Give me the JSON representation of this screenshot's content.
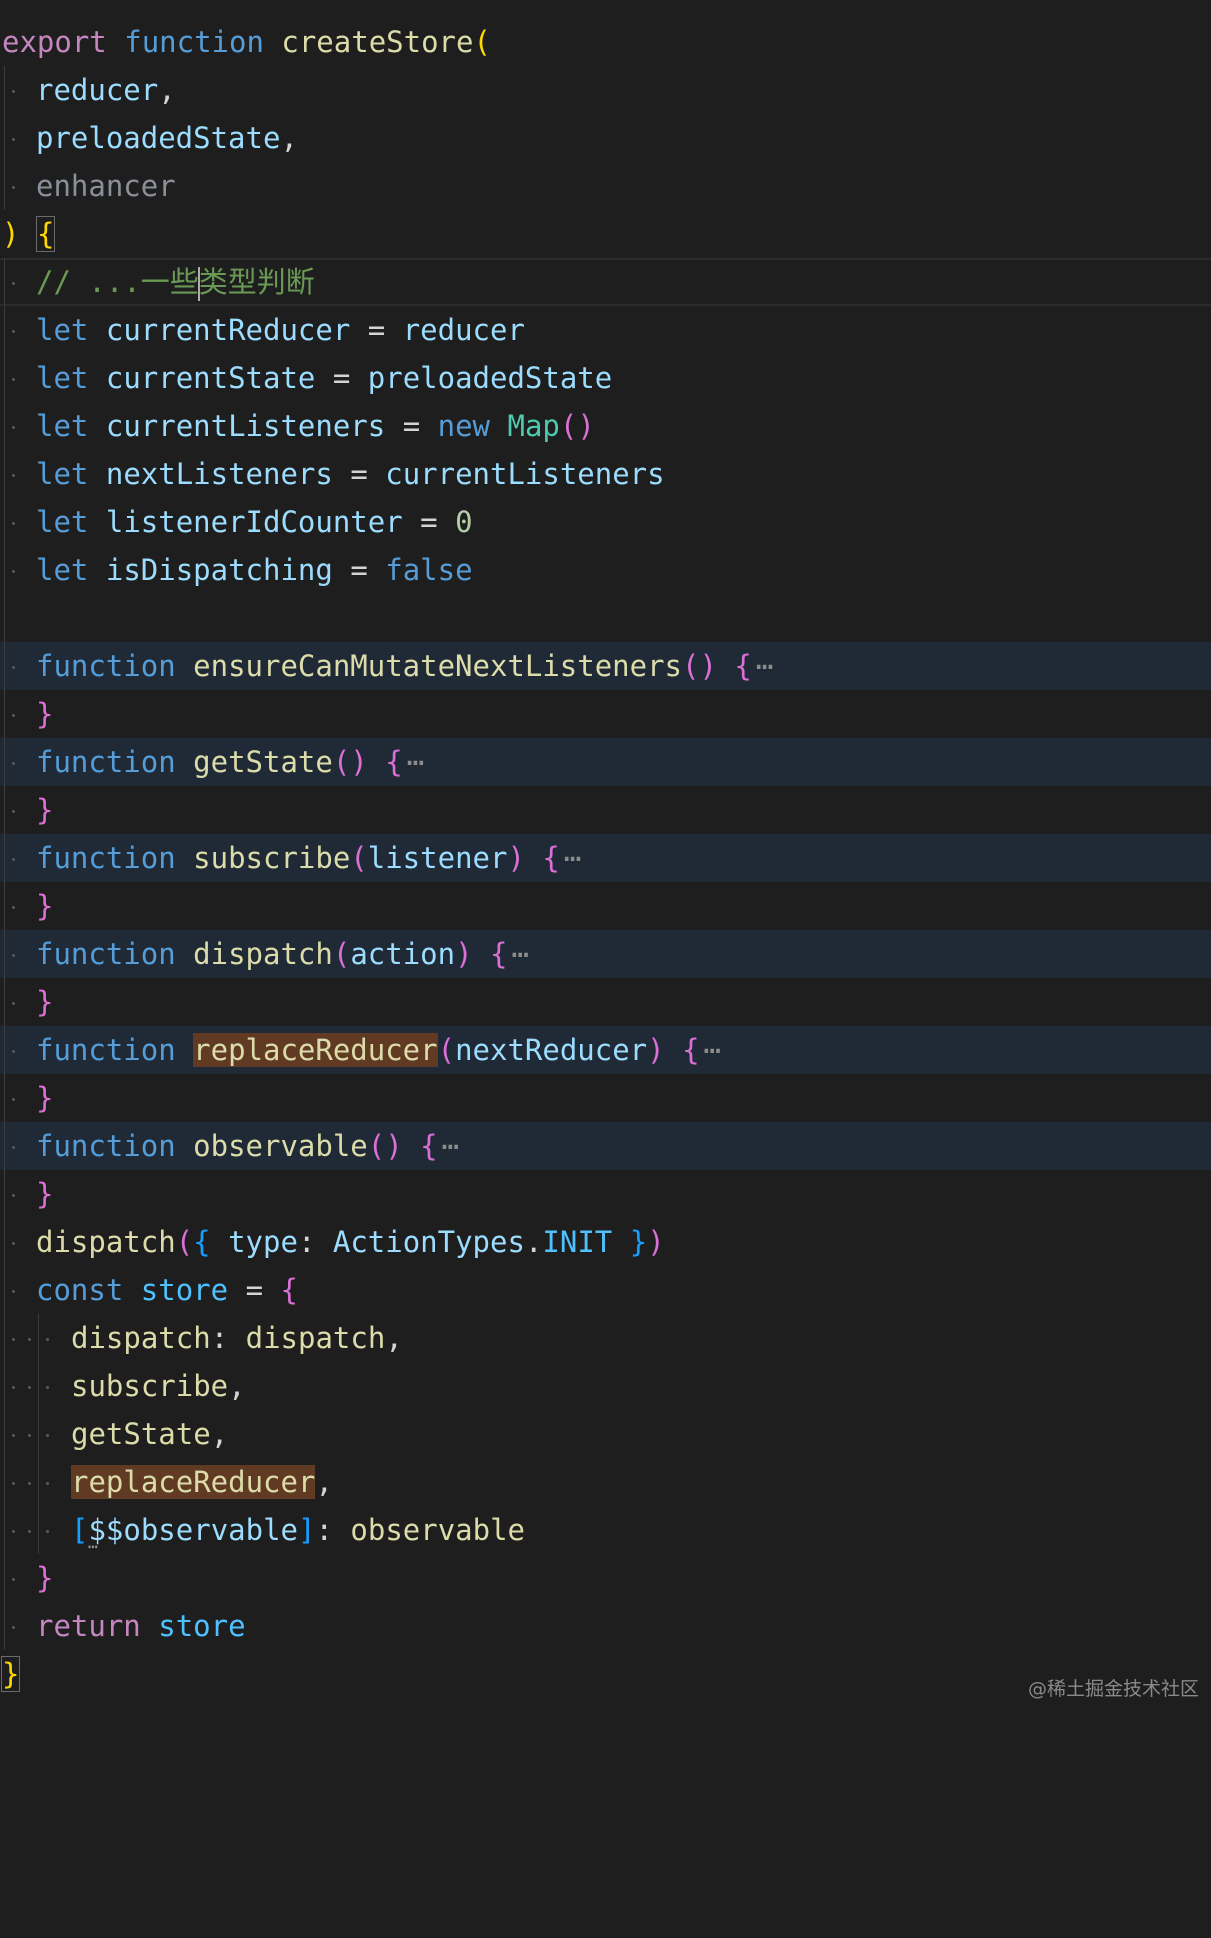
{
  "editor": {
    "language": "javascript",
    "theme": "dark",
    "colors": {
      "background": "#1e1e1e",
      "folded_region_highlight": "#1f2a36",
      "occurrence_highlight": "#613a24",
      "keyword": "#569cd6",
      "control_keyword": "#c586c0",
      "function_name": "#dcdcaa",
      "variable": "#9cdcfe",
      "comment": "#6a9955",
      "bracket_level_1": "#ffd700",
      "bracket_level_2": "#da70d6",
      "bracket_level_3": "#179fff"
    },
    "lines": [
      {
        "id": "l1",
        "text": "export function createStore("
      },
      {
        "id": "l2",
        "text": "reducer,"
      },
      {
        "id": "l3",
        "text": "preloadedState,"
      },
      {
        "id": "l4",
        "text": "enhancer"
      },
      {
        "id": "l5",
        "text": ") {"
      },
      {
        "id": "l6",
        "text": "// ...一些类型判断",
        "comment_a": "// ...一些",
        "comment_b": "类型判断"
      },
      {
        "id": "l7",
        "text": "let currentReducer = reducer"
      },
      {
        "id": "l8",
        "text": "let currentState = preloadedState"
      },
      {
        "id": "l9",
        "text": "let currentListeners = new Map()"
      },
      {
        "id": "l10",
        "text": "let nextListeners = currentListeners"
      },
      {
        "id": "l11",
        "text": "let listenerIdCounter = 0"
      },
      {
        "id": "l12",
        "text": "let isDispatching = false"
      },
      {
        "id": "l13",
        "text": ""
      },
      {
        "id": "l14",
        "text": "function ensureCanMutateNextListeners() {⋯",
        "folded": true
      },
      {
        "id": "l15",
        "text": "}"
      },
      {
        "id": "l16",
        "text": "function getState() {⋯",
        "folded": true
      },
      {
        "id": "l17",
        "text": "}"
      },
      {
        "id": "l18",
        "text": "function subscribe(listener) {⋯",
        "folded": true
      },
      {
        "id": "l19",
        "text": "}"
      },
      {
        "id": "l20",
        "text": "function dispatch(action) {⋯",
        "folded": true
      },
      {
        "id": "l21",
        "text": "}"
      },
      {
        "id": "l22",
        "text": "function replaceReducer(nextReducer) {⋯",
        "folded": true,
        "highlighted_word": "replaceReducer"
      },
      {
        "id": "l23",
        "text": "}"
      },
      {
        "id": "l24",
        "text": "function observable() {⋯",
        "folded": true
      },
      {
        "id": "l25",
        "text": "}"
      },
      {
        "id": "l26",
        "text": "dispatch({ type: ActionTypes.INIT })"
      },
      {
        "id": "l27",
        "text": "const store = {"
      },
      {
        "id": "l28",
        "text": "dispatch: dispatch,"
      },
      {
        "id": "l29",
        "text": "subscribe,"
      },
      {
        "id": "l30",
        "text": "getState,"
      },
      {
        "id": "l31",
        "text": "replaceReducer,",
        "highlighted_word": "replaceReducer"
      },
      {
        "id": "l32",
        "text": "[$$observable]: observable"
      },
      {
        "id": "l33",
        "text": "}"
      },
      {
        "id": "l34",
        "text": "return store"
      },
      {
        "id": "l35",
        "text": "}"
      }
    ],
    "tokens": {
      "export": "export",
      "function": "function",
      "let": "let",
      "new": "new",
      "false": "false",
      "const": "const",
      "return": "return",
      "paren_open": "(",
      "paren_close": ")",
      "parens": "()",
      "brace_open": "{",
      "brace_close": "}",
      "bracket_open": "[",
      "bracket_close": "]",
      "comma": ",",
      "colon": ":",
      "dot": ".",
      "eq": "=",
      "ellipsis": "⋯",
      "createStore": "createStore",
      "reducer": "reducer",
      "preloadedState": "preloadedState",
      "enhancer": "enhancer",
      "currentReducer": "currentReducer",
      "currentState": "currentState",
      "currentListeners": "currentListeners",
      "Map": "Map",
      "nextListeners": "nextListeners",
      "listenerIdCounter": "listenerIdCounter",
      "zero": "0",
      "isDispatching": "isDispatching",
      "ensureCanMutateNextListeners": "ensureCanMutateNextListeners",
      "getState": "getState",
      "subscribe": "subscribe",
      "listener": "listener",
      "dispatch": "dispatch",
      "action": "action",
      "replaceReducer": "replaceReducer",
      "nextReducer": "nextReducer",
      "observable": "observable",
      "type": "type",
      "ActionTypes": "ActionTypes",
      "INIT": "INIT",
      "store": "store",
      "dollars": "$$"
    }
  },
  "watermark": "@稀土掘金技术社区"
}
